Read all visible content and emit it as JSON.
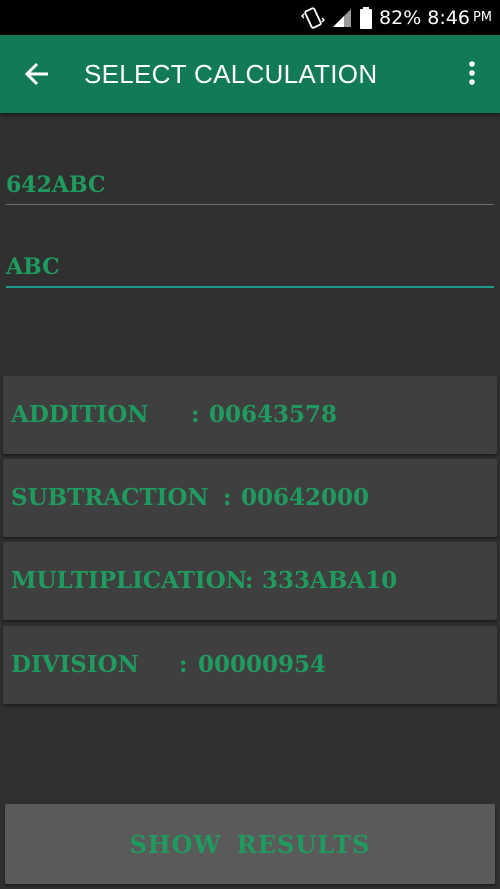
{
  "status_bar": {
    "battery": "82%",
    "time": "8:46",
    "ampm": "PM",
    "icons": [
      "vibrate-icon",
      "signal-icon",
      "battery-icon"
    ]
  },
  "app_bar": {
    "title": "SELECT CALCULATION",
    "back_icon": "arrow-back-icon",
    "menu_icon": "more-vert-icon",
    "color": "#127a54"
  },
  "inputs": {
    "first_value": "642ABC",
    "second_value": "ABC"
  },
  "results": [
    {
      "label": "ADDITION",
      "separator": ":",
      "value": "00643578"
    },
    {
      "label": "SUBTRACTION",
      "separator": ":",
      "value": "00642000"
    },
    {
      "label": "MULTIPLICATION",
      "separator": ":",
      "value": "333ABA10"
    },
    {
      "label": "DIVISION",
      "separator": ":",
      "value": "00000954"
    }
  ],
  "show_results_button": {
    "label": "SHOW  RESULTS"
  },
  "colors": {
    "accent_text": "#1e9b5e",
    "background": "#303030",
    "card": "#3f3f3f",
    "input_underline": "#1d9a8a"
  }
}
